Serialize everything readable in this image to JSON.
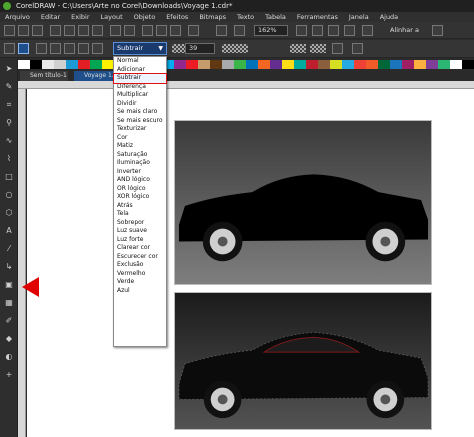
{
  "window": {
    "title": "CorelDRAW - C:\\Users\\Arte no Corel\\Downloads\\Voyage 1.cdr*"
  },
  "menubar": [
    "Arquivo",
    "Editar",
    "Exibir",
    "Layout",
    "Objeto",
    "Efeitos",
    "Bitmaps",
    "Texto",
    "Tabela",
    "Ferramentas",
    "Janela",
    "Ajuda"
  ],
  "toolbar": {
    "zoom": "162%",
    "snap_label": "Alinhar a"
  },
  "propbar": {
    "blend_mode": "Subtrair",
    "amount": "39"
  },
  "tabs": [
    "Sem título-1",
    "Voyage 1.cdr*"
  ],
  "blend_menu": {
    "selected": "Subtrair",
    "items": [
      "Normal",
      "Adicionar",
      "Subtrair",
      "Diferença",
      "Multiplicar",
      "Dividir",
      "Se mais claro",
      "Se mais escuro",
      "Texturizar",
      "Cor",
      "Matiz",
      "Saturação",
      "Iluminação",
      "Inverter",
      "AND lógico",
      "OR lógico",
      "XOR lógico",
      "Atrás",
      "Tela",
      "Sobrepor",
      "Luz suave",
      "Luz forte",
      "Clarear cor",
      "Escurecer cor",
      "Exclusão",
      "Vermelho",
      "Verde",
      "Azul"
    ]
  },
  "palette_colors": [
    "#ffffff",
    "#000000",
    "#e8e8e8",
    "#d0d0d0",
    "#1b9ad6",
    "#e31e24",
    "#00a651",
    "#fff200",
    "#ec008c",
    "#2e3192",
    "#f7941d",
    "#8dc63f",
    "#00aeef",
    "#92278f",
    "#ed1c24",
    "#c69c6d",
    "#603913",
    "#a7a9ac",
    "#39b54a",
    "#0072bc",
    "#f26522",
    "#662d91",
    "#ffde17",
    "#00a99d",
    "#be1e2d",
    "#8b5e3c",
    "#d7df23",
    "#27aae1",
    "#ef4136",
    "#f15a29",
    "#006838",
    "#1c75bc",
    "#9e1f63",
    "#fbb040",
    "#7f3f98",
    "#2bb673",
    "#ffffff",
    "#000000"
  ],
  "accent": "#1e4f8a",
  "annotation_color": "#e00000"
}
